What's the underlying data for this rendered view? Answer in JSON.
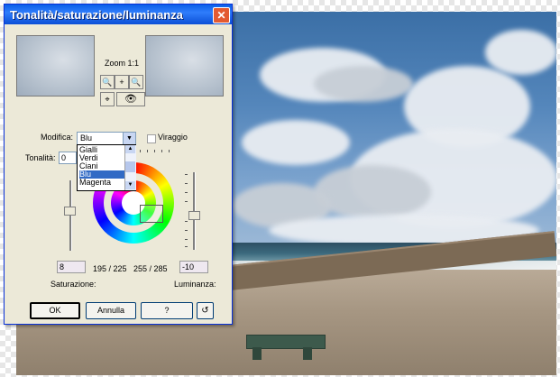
{
  "dialog": {
    "title": "Tonalità/saturazione/luminanza",
    "zoom_label": "Zoom 1:1",
    "modifica_label": "Modifica:",
    "modifica_value": "Blu",
    "viraggio_label": "Viraggio",
    "tonalita_label": "Tonalità:",
    "tonalita_value": "0",
    "dropdown_items": [
      "Gialli",
      "Verdi",
      "Ciani",
      "Blu",
      "Magenta"
    ],
    "selected_item": "Blu",
    "saturation_value": "8",
    "range_left": "195 / 225",
    "range_right": "255 / 285",
    "luminance_value": "-10",
    "saturazione_label": "Saturazione:",
    "luminanza_label": "Luminanza:",
    "buttons": {
      "ok": "OK",
      "cancel": "Annulla",
      "help": "?"
    }
  },
  "icons": [
    "close-icon",
    "zoom-in-icon",
    "pan-icon",
    "zoom-out-icon",
    "pick-color-icon",
    "eye-icon",
    "reset-icon"
  ]
}
